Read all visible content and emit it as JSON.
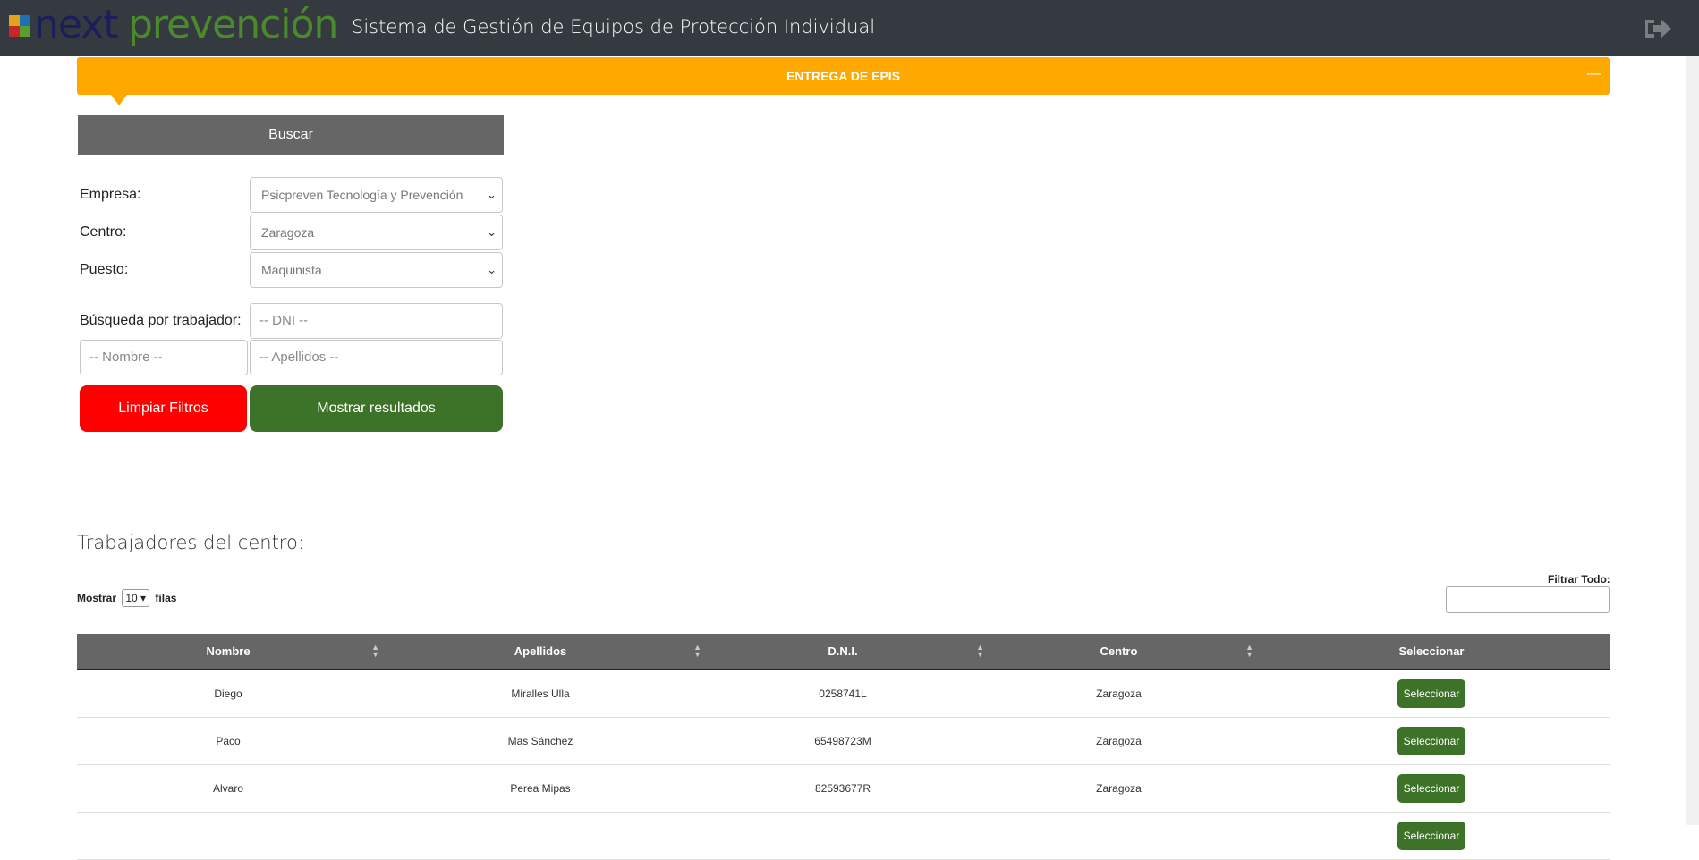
{
  "header": {
    "logo_next": "next",
    "logo_prevencion": "prevención",
    "app_title": "Sistema de Gestión de Equipos de Protección Individual",
    "logout_icon": "sign-out-icon"
  },
  "banner": {
    "title": "ENTREGA DE EPIS",
    "collapse_symbol": "—",
    "color": "#ffa800"
  },
  "search": {
    "header_label": "Buscar",
    "empresa_label": "Empresa:",
    "empresa_value": "Psicpreven Tecnología y Prevención",
    "centro_label": "Centro:",
    "centro_value": "Zaragoza",
    "puesto_label": "Puesto:",
    "puesto_value": "Maquinista",
    "worker_search_label": "Búsqueda por trabajador:",
    "dni_placeholder": "-- DNI --",
    "nombre_placeholder": "-- Nombre --",
    "apellidos_placeholder": "-- Apellidos --",
    "clear_button": "Limpiar Filtros",
    "show_button": "Mostrar resultados"
  },
  "workers": {
    "title": "Trabajadores del centro:",
    "show_label": "Mostrar",
    "rows_value": "10",
    "rows_suffix": "filas",
    "filter_label": "Filtrar Todo:",
    "columns": [
      "Nombre",
      "Apellidos",
      "D.N.I.",
      "Centro",
      "Seleccionar"
    ],
    "select_label": "Seleccionar",
    "rows": [
      {
        "nombre": "Diego",
        "apellidos": "Miralles Ulla",
        "dni": "0258741L",
        "centro": "Zaragoza"
      },
      {
        "nombre": "Paco",
        "apellidos": "Mas Sánchez",
        "dni": "65498723M",
        "centro": "Zaragoza"
      },
      {
        "nombre": "Alvaro",
        "apellidos": "Perea Mipas",
        "dni": "82593677R",
        "centro": "Zaragoza"
      }
    ]
  },
  "colors": {
    "topbar": "#353a40",
    "accent_orange": "#ffa800",
    "green": "#3d7329",
    "red": "#ff0000",
    "gray_header": "#666666"
  }
}
